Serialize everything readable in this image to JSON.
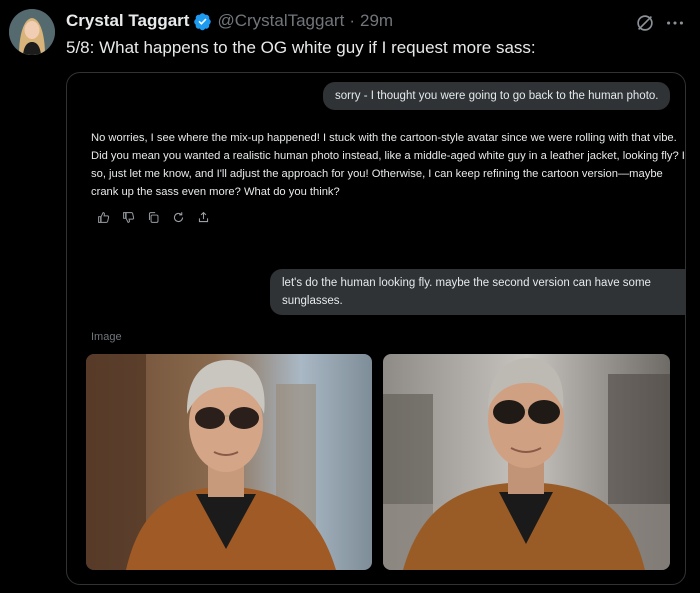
{
  "author": {
    "display_name": "Crystal Taggart",
    "handle": "@CrystalTaggart",
    "separator": "·",
    "time": "29m"
  },
  "tweet": {
    "text": "5/8: What happens to the OG white guy if I request more sass:"
  },
  "chat": {
    "user_message_1": "sorry - I thought you were going to go back to the human photo.",
    "ai_response": "No worries, I see where the mix-up happened! I stuck with the cartoon-style avatar since we were rolling with that vibe. Did you mean you wanted a realistic human photo instead, like a middle-aged white guy in a leather jacket, looking fly? If so, just let me know, and I'll adjust the approach for you! Otherwise, I can keep refining the cartoon version—maybe crank up the sass even more? What do you think?",
    "user_message_2": "let's do the human looking fly. maybe the second version can have some sunglasses.",
    "image_label": "Image"
  },
  "icons": {
    "verified": "verified-badge-icon",
    "grok": "grok-icon",
    "more": "more-icon",
    "actions": [
      "thumbs-up-icon",
      "thumbs-down-icon",
      "copy-icon",
      "regenerate-icon",
      "share-icon"
    ]
  },
  "colors": {
    "background": "#000000",
    "text": "#e7e9ea",
    "muted": "#71767b",
    "bubble": "#2f3336",
    "verified": "#1d9bf0"
  }
}
